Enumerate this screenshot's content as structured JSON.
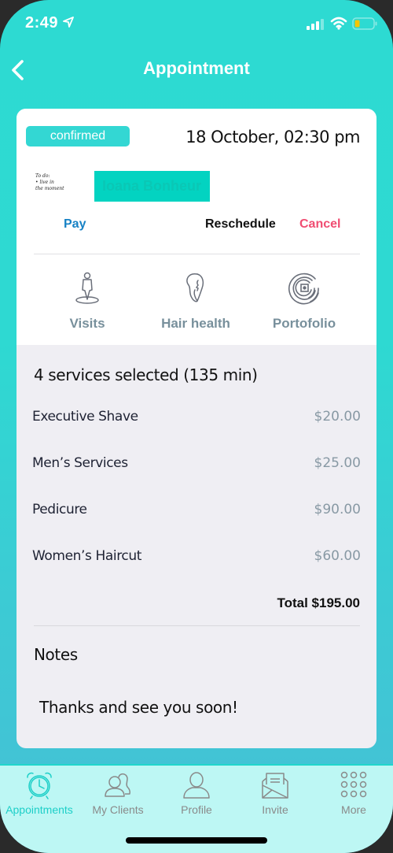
{
  "status_bar": {
    "time": "2:49",
    "icons": [
      "location-arrow-icon",
      "signal-icon",
      "wifi-icon",
      "battery-icon"
    ],
    "battery_color": "#f5c400"
  },
  "nav": {
    "title": "Appointment",
    "back_icon": "chevron-left-icon"
  },
  "appointment": {
    "status": "confirmed",
    "datetime": "18 October, 02:30 pm",
    "avatar_text": [
      "To do:",
      "• live in",
      "the moment"
    ],
    "client_name": "Ioana  Bonheur",
    "actions": {
      "pay": "Pay",
      "reschedule": "Reschedule",
      "cancel": "Cancel"
    },
    "features": [
      {
        "label": "Visits",
        "icon": "person-pin-icon"
      },
      {
        "label": "Hair health",
        "icon": "hair-profile-icon"
      },
      {
        "label": "Portofolio",
        "icon": "camera-lens-icon"
      }
    ]
  },
  "services": {
    "title": "4 services selected (135 min)",
    "items": [
      {
        "name": "Executive Shave",
        "price": "$20.00"
      },
      {
        "name": "Men’s Services",
        "price": "$25.00"
      },
      {
        "name": "Pedicure",
        "price": "$90.00"
      },
      {
        "name": "Women’s Haircut",
        "price": "$60.00"
      }
    ],
    "total": "Total $195.00"
  },
  "notes": {
    "title": "Notes",
    "text": "Thanks and see you soon!"
  },
  "tab_bar": {
    "active_index": 0,
    "tabs": [
      {
        "label": "Appointments",
        "icon": "alarm-clock-icon"
      },
      {
        "label": "My Clients",
        "icon": "users-icon"
      },
      {
        "label": "Profile",
        "icon": "user-icon"
      },
      {
        "label": "Invite",
        "icon": "envelope-open-icon"
      },
      {
        "label": "More",
        "icon": "grid-dots-icon"
      }
    ]
  },
  "colors": {
    "brand_teal": "#2ddad2",
    "badge": "#33d7d3",
    "pay_blue": "#1782c5",
    "cancel_red": "#f04d72",
    "tab_active": "#1dcfc8",
    "tab_inactive": "#8a8a8a",
    "tab_bar_bg": "#bdf7f4"
  }
}
